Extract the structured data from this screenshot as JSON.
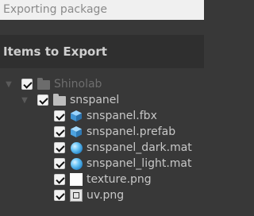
{
  "window": {
    "title": "Exporting package"
  },
  "header": {
    "title": "Items to Export"
  },
  "tree": {
    "root": {
      "label": "Shinolab",
      "checked": true,
      "expanded": true
    },
    "folder": {
      "label": "snspanel",
      "checked": true,
      "expanded": true
    },
    "items": [
      {
        "label": "snspanel.fbx",
        "icon": "model-cube-icon",
        "checked": true
      },
      {
        "label": "snspanel.prefab",
        "icon": "prefab-cube-icon",
        "checked": true
      },
      {
        "label": "snspanel_dark.mat",
        "icon": "material-sphere-icon",
        "checked": true
      },
      {
        "label": "snspanel_light.mat",
        "icon": "material-sphere-icon",
        "checked": true
      },
      {
        "label": "texture.png",
        "icon": "image-icon",
        "checked": true
      },
      {
        "label": "uv.png",
        "icon": "image-icon",
        "checked": true
      }
    ]
  }
}
